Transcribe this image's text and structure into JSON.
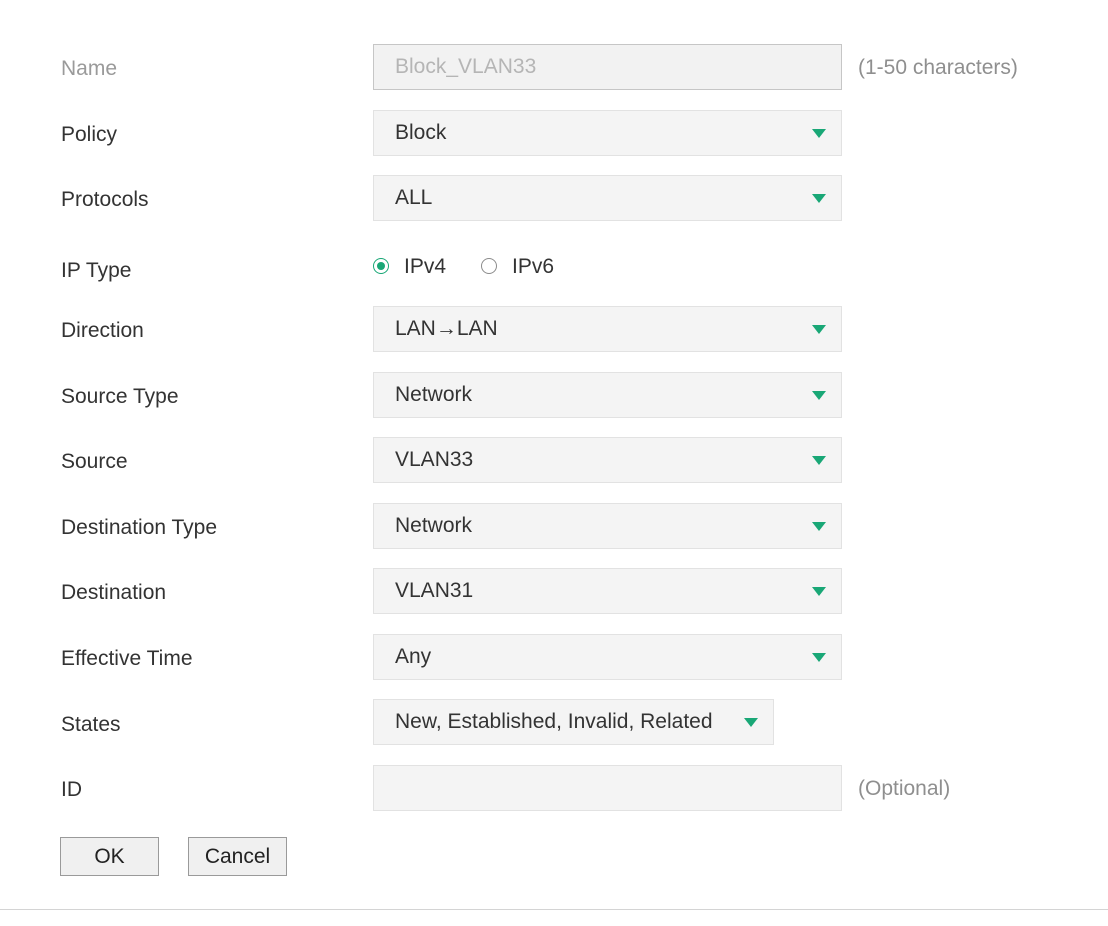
{
  "form": {
    "name": {
      "label": "Name",
      "value": "Block_VLAN33",
      "hint": "(1-50 characters)",
      "disabled": true
    },
    "policy": {
      "label": "Policy",
      "value": "Block"
    },
    "protocols": {
      "label": "Protocols",
      "value": "ALL"
    },
    "ip_type": {
      "label": "IP Type",
      "options": [
        {
          "label": "IPv4",
          "checked": true
        },
        {
          "label": "IPv6",
          "checked": false
        }
      ]
    },
    "direction": {
      "label": "Direction",
      "value": "LAN→LAN"
    },
    "source_type": {
      "label": "Source Type",
      "value": "Network"
    },
    "source": {
      "label": "Source",
      "value": "VLAN33"
    },
    "destination_type": {
      "label": "Destination Type",
      "value": "Network"
    },
    "destination": {
      "label": "Destination",
      "value": "VLAN31"
    },
    "effective_time": {
      "label": "Effective Time",
      "value": "Any"
    },
    "states": {
      "label": "States",
      "value": "New, Established, Invalid, Related"
    },
    "id": {
      "label": "ID",
      "value": "",
      "hint": "(Optional)"
    }
  },
  "buttons": {
    "ok": "OK",
    "cancel": "Cancel"
  },
  "colors": {
    "accent": "#19a776",
    "field_bg": "#f4f4f4",
    "disabled_text": "#b5b5b5"
  },
  "icons": {
    "dropdown": "caret-down-icon",
    "radio_checked": "radio-checked-icon",
    "radio_unchecked": "radio-unchecked-icon"
  }
}
